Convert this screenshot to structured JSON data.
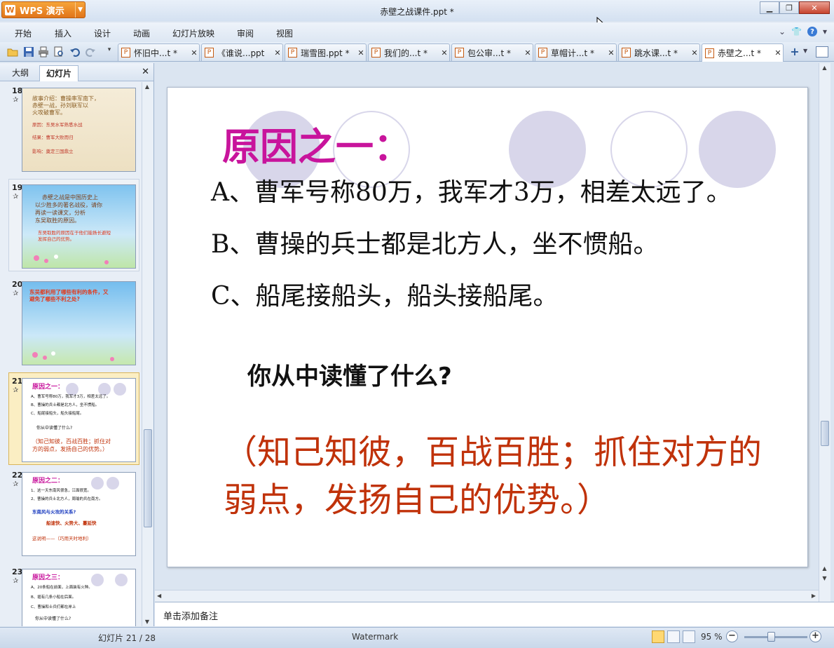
{
  "window": {
    "app_name": "WPS 演示",
    "title": "赤壁之战课件.ppt *"
  },
  "menu": [
    "开始",
    "插入",
    "设计",
    "动画",
    "幻灯片放映",
    "审阅",
    "视图"
  ],
  "doc_tabs": [
    {
      "label": "怀旧中...t *"
    },
    {
      "label": "《谁说...ppt"
    },
    {
      "label": "瑞雪图.ppt *"
    },
    {
      "label": "我们的...t *"
    },
    {
      "label": "包公审...t *"
    },
    {
      "label": "草帽计...t *"
    },
    {
      "label": "跳水课...t *"
    },
    {
      "label": "赤壁之...t *"
    }
  ],
  "side_panel": {
    "tab_outline": "大纲",
    "tab_slides": "幻灯片"
  },
  "thumbnails": [
    {
      "number": "18",
      "lines": [
        "故事介绍：曹操率军南下，",
        "赤壁一战，孙刘联军以",
        "火攻破曹军。",
        "原因：东吴水军熟悉水战",
        "结果：曹军大败而归",
        "影响：奠定三国鼎立"
      ]
    },
    {
      "number": "19",
      "lines": [
        "赤壁之战是中国历史上",
        "以少胜多的著名战役，请你",
        "再读一读课文，分析",
        "东吴取胜的原因。",
        "东吴取胜的原因在于他们能扬长避短",
        "发挥自己的优势。"
      ]
    },
    {
      "number": "20",
      "lines": [
        "东吴都利用了哪些有利的条件，又",
        "避免了哪些不利之处?"
      ]
    },
    {
      "number": "21",
      "lines": [
        "原因之一：",
        "A、曹军号称80万，我军才3万，相差太远了。",
        "B、曹操的兵士都是北方人，坐不惯船。",
        "C、船尾接船头，船头接船尾。",
        "你从中读懂了什么?",
        "（知己知彼，百战百胜；抓住对",
        "方的弱点，发扬自己的优势。）"
      ]
    },
    {
      "number": "22",
      "lines": [
        "原因之二：",
        "1、这一天东南风很急，江面很宽。",
        "2、曹操的兵士北方人，周瑜的兵在南方。",
        "东南风与火攻的关系?",
        "船速快、火势大、蔓延快",
        "这说明——（巧用天时地利）"
      ]
    },
    {
      "number": "23",
      "lines": [
        "原因之三：",
        "A、20条船在前面，上面装有火种。",
        "B、插有几条小船在后面。",
        "C、曹操和士兵们都在岸上",
        "你从中读懂了什么?"
      ]
    }
  ],
  "slide": {
    "title": "原因之一：",
    "line_a": "A、曹军号称80万，我军才3万，相差太远了。",
    "line_b": "B、曹操的兵士都是北方人，坐不惯船。",
    "line_c": "C、船尾接船头，船头接船尾。",
    "question": "你从中读懂了什么?",
    "answer": "（知己知彼，百战百胜；抓住对方的弱点，发扬自己的优势。）"
  },
  "notes_placeholder": "单击添加备注",
  "status": {
    "slide_info": "幻灯片 21 / 28",
    "watermark": "Watermark",
    "zoom": "95 %"
  }
}
